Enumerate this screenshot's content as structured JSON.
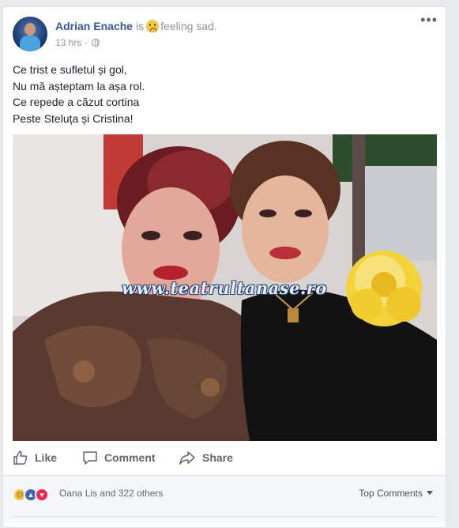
{
  "post": {
    "author": "Adrian Enache",
    "is_word": "is",
    "feeling_icon": "sad-face-emoji",
    "feeling_text": "feeling sad.",
    "time": "13 hrs",
    "meta_separator": "·",
    "privacy_icon": "globe-icon",
    "more_label": "•••",
    "lines": [
      "Ce trist e sufletul și gol,",
      "Nu mă așteptam la așa rol.",
      "Ce repede a căzut cortina",
      "Peste Steluța și Cristina!"
    ],
    "photo": {
      "watermark": "www.teatrultanase.ro",
      "subject": "photo-two-women"
    }
  },
  "actions": {
    "like": "Like",
    "comment": "Comment",
    "share": "Share"
  },
  "reactions": {
    "icons": [
      "sad-reaction",
      "like-reaction",
      "love-reaction"
    ],
    "summary": "Oana Lis and 322 others",
    "top_comments": "Top Comments"
  },
  "colors": {
    "link": "#365899",
    "muted": "#90949c",
    "action_text": "#606770",
    "like_blue": "#4267b2",
    "love_red": "#f0284a",
    "sad_yellow": "#f7c84a"
  }
}
